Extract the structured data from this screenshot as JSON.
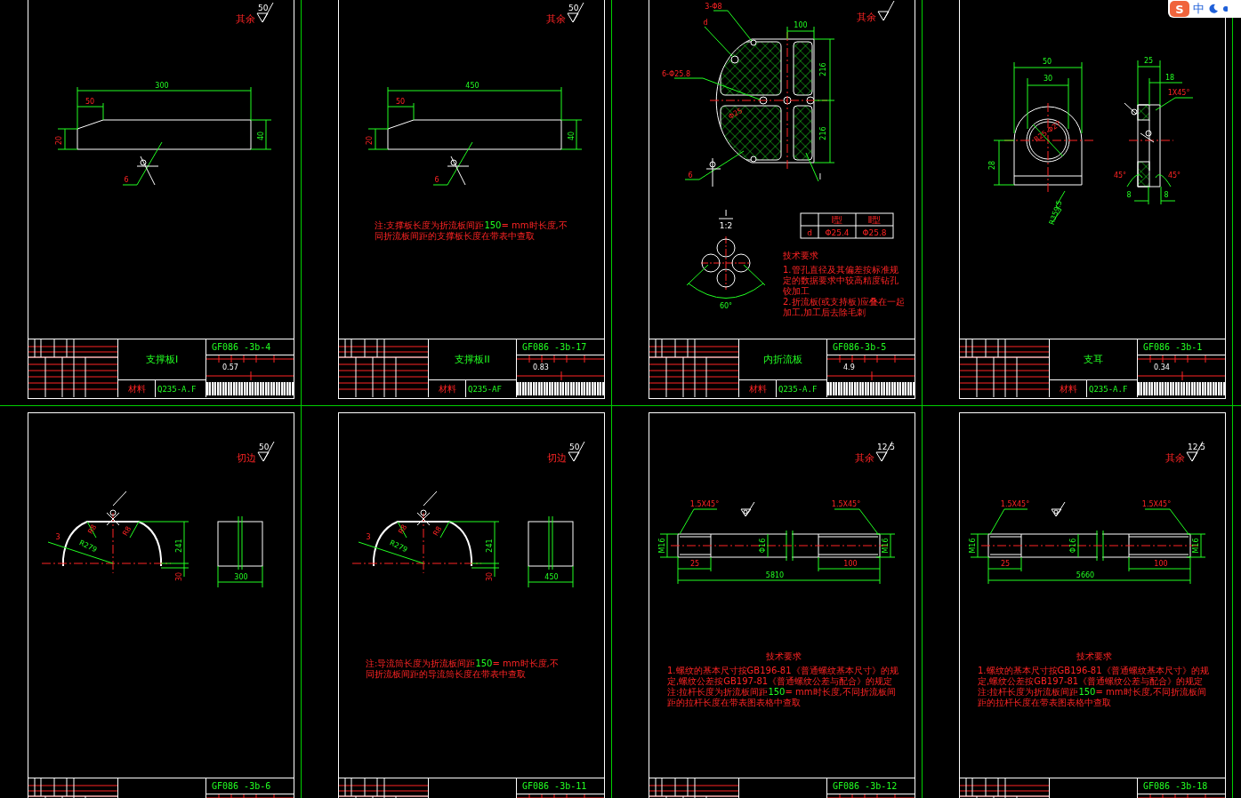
{
  "sheets": [
    {
      "kind": "plate",
      "roughness": {
        "label": "其余",
        "value": "50"
      },
      "labels": [
        "300",
        "50",
        "20",
        "40",
        "6"
      ],
      "title_block": {
        "name": "支撑板I",
        "number": "GF086 -3b-4",
        "mass": "0.57",
        "material_label": "材料",
        "material": "Q235-A.F"
      }
    },
    {
      "kind": "plate",
      "roughness": {
        "label": "其余",
        "value": "50"
      },
      "labels": [
        "450",
        "50",
        "20",
        "40",
        "6"
      ],
      "note": {
        "before": "注:支撑板长度为折流板间距",
        "value": "150",
        "after": "= mm时长度,不同折流板间距的支撑板长度在带表中查取"
      },
      "title_block": {
        "name": "支撑板II",
        "number": "GF086 -3b-17",
        "mass": "0.83",
        "material_label": "材料",
        "material": "Q235-AF"
      }
    },
    {
      "kind": "baffle",
      "roughness": {
        "label": "其余"
      },
      "labels": [
        "3-Φ8",
        "d",
        "6-Φ25.8",
        "Φ25",
        "6",
        "100",
        "216",
        "216",
        "I"
      ],
      "detail": {
        "title": "I",
        "scale": "1:2",
        "labels": [
          "60°"
        ]
      },
      "table": {
        "header": [
          "Ⅰ型",
          "Ⅱ型"
        ],
        "rows": [
          {
            "label": "d",
            "values": [
              "Φ25.4",
              "Φ25.8"
            ]
          }
        ]
      },
      "requirements": {
        "title": "技术要求",
        "items": [
          "1.管孔直径及其偏差按标准规定的数据要求中较高精度钻孔铰加工",
          "2.折流板(或支持板)应叠在一起加工,加工后去除毛刺"
        ]
      },
      "title_block": {
        "name": "内折流板",
        "number": "GF086-3b-5",
        "mass": "4.9",
        "material_label": "材料",
        "material": "Q235-A.F"
      }
    },
    {
      "kind": "lug",
      "labels": [
        "50",
        "30",
        "28",
        "R25 Φ27",
        "R359.5",
        "25",
        "18",
        "1X45°",
        "45°",
        "45°",
        "8",
        "8"
      ],
      "title_block": {
        "name": "支耳",
        "number": "GF086 -3b-1",
        "mass": "0.34",
        "material_label": "材料",
        "material": "Q235-A.F"
      }
    },
    {
      "kind": "shell",
      "roughness": {
        "label": "切边",
        "value": "50"
      },
      "labels": [
        "3",
        "R279",
        "R8",
        "R8",
        "241",
        "30",
        "300"
      ],
      "title_block": {
        "number": "GF086 -3b-6"
      }
    },
    {
      "kind": "shell",
      "roughness": {
        "label": "切边",
        "value": "50"
      },
      "labels": [
        "3",
        "R279",
        "R8",
        "R8",
        "241",
        "30",
        "450"
      ],
      "note": {
        "before": "注:导流筒长度为折流板间距",
        "value": "150",
        "after": "= mm时长度,不同折流板间距的导流筒长度在带表中查取"
      },
      "title_block": {
        "number": "GF086 -3b-11"
      }
    },
    {
      "kind": "rod",
      "roughness": {
        "label": "其余",
        "value": "12.5"
      },
      "labels": [
        "1.5X45°",
        "1.5X45°",
        "M16",
        "Φ16",
        "M16",
        "25",
        "100",
        "5810"
      ],
      "requirements": {
        "title": "技术要求",
        "items": [
          "1.螺纹的基本尺寸按GB196-81《普通螺纹基本尺寸》的规定,螺纹公差按GB197-81《普通螺纹公差与配合》的规定"
        ]
      },
      "note": {
        "before": "注:拉杆长度为折流板间距",
        "value": "150",
        "after": "= mm时长度,不同折流板间距的拉杆长度在带表图表格中查取"
      },
      "title_block": {
        "number": "GF086 -3b-12"
      }
    },
    {
      "kind": "rod",
      "roughness": {
        "label": "其余",
        "value": "12.5"
      },
      "labels": [
        "1.5X45°",
        "1.5X45°",
        "M16",
        "Φ16",
        "M16",
        "25",
        "100",
        "5660"
      ],
      "requirements": {
        "title": "技术要求",
        "items": [
          "1.螺纹的基本尺寸按GB196-81《普通螺纹基本尺寸》的规定,螺纹公差按GB197-81《普通螺纹公差与配合》的规定"
        ]
      },
      "note": {
        "before": "注:拉杆长度为折流板间距",
        "value": "150",
        "after": "= mm时长度,不同折流板间距的拉杆长度在带表图表格中查取"
      },
      "title_block": {
        "number": "GF086 -3b-18"
      }
    }
  ],
  "ime": {
    "logo": "S",
    "mode": "中"
  }
}
